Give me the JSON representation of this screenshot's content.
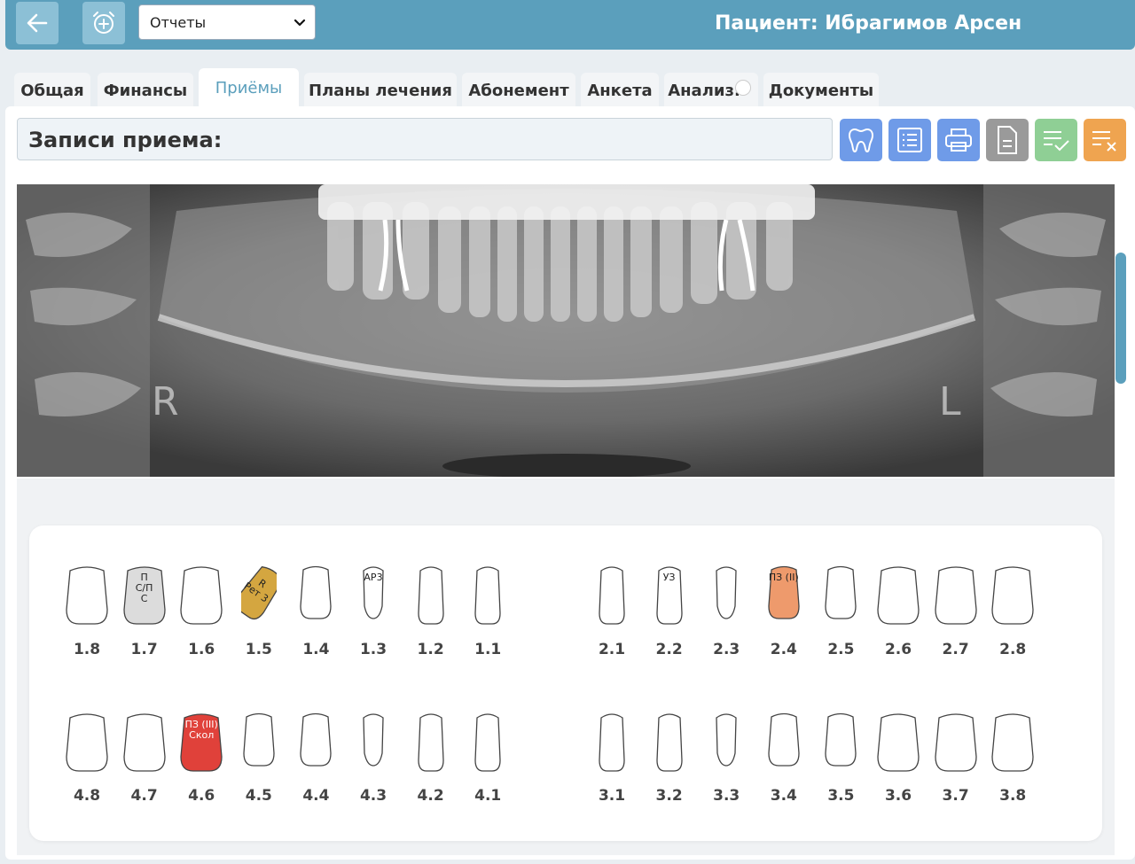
{
  "header": {
    "back_icon": "arrow-left-icon",
    "alarm_icon": "alarm-plus-icon",
    "select_value": "Отчеты",
    "patient_title": "Пациент: Ибрагимов Арсен"
  },
  "tabs": [
    {
      "label": "Общая",
      "active": false
    },
    {
      "label": "Финансы",
      "active": false
    },
    {
      "label": "Приёмы",
      "active": true
    },
    {
      "label": "Планы лечения",
      "active": false
    },
    {
      "label": "Абонемент",
      "active": false
    },
    {
      "label": "Анкета",
      "active": false
    },
    {
      "label": "Анализ.",
      "active": false
    },
    {
      "label": "Документы",
      "active": false
    }
  ],
  "records": {
    "title": "Записи приема:"
  },
  "toolbar": {
    "colors": {
      "blue": "#6f9be8",
      "gray": "#9a9a9a",
      "green": "#8fcf95",
      "orange": "#efa450"
    },
    "buttons": [
      {
        "icon": "tooth-icon",
        "color": "blue"
      },
      {
        "icon": "list-icon",
        "color": "blue"
      },
      {
        "icon": "printer-icon",
        "color": "blue"
      },
      {
        "icon": "document-icon",
        "color": "gray"
      },
      {
        "icon": "list-check-icon",
        "color": "green"
      },
      {
        "icon": "list-remove-icon",
        "color": "orange"
      }
    ]
  },
  "xray": {
    "left_marker": "R",
    "right_marker": "L"
  },
  "dental_chart": {
    "status_colors": {
      "gray": "#dcdcdc",
      "gold": "#d4a640",
      "orange": "#ee9a6c",
      "red": "#e0413a"
    },
    "upper_right": [
      {
        "number": "1.8",
        "shape": "molar",
        "mark": "",
        "fill": ""
      },
      {
        "number": "1.7",
        "shape": "molar",
        "mark": "П\nС/П\nС",
        "fill": "gray"
      },
      {
        "number": "1.6",
        "shape": "molar",
        "mark": "",
        "fill": ""
      },
      {
        "number": "1.5",
        "shape": "premolar",
        "mark": "R\nРет 3",
        "fill": "gold"
      },
      {
        "number": "1.4",
        "shape": "premolar",
        "mark": "",
        "fill": ""
      },
      {
        "number": "1.3",
        "shape": "canine",
        "mark": "АР3",
        "fill": ""
      },
      {
        "number": "1.2",
        "shape": "incisor",
        "mark": "",
        "fill": ""
      },
      {
        "number": "1.1",
        "shape": "incisor",
        "mark": "",
        "fill": ""
      }
    ],
    "upper_left": [
      {
        "number": "2.1",
        "shape": "incisor",
        "mark": "",
        "fill": ""
      },
      {
        "number": "2.2",
        "shape": "incisor",
        "mark": "УЗ",
        "fill": ""
      },
      {
        "number": "2.3",
        "shape": "canine",
        "mark": "",
        "fill": ""
      },
      {
        "number": "2.4",
        "shape": "premolar",
        "mark": "ПЗ (II)",
        "fill": "orange"
      },
      {
        "number": "2.5",
        "shape": "premolar",
        "mark": "",
        "fill": ""
      },
      {
        "number": "2.6",
        "shape": "molar",
        "mark": "",
        "fill": ""
      },
      {
        "number": "2.7",
        "shape": "molar",
        "mark": "",
        "fill": ""
      },
      {
        "number": "2.8",
        "shape": "molar",
        "mark": "",
        "fill": ""
      }
    ],
    "lower_right": [
      {
        "number": "4.8",
        "shape": "molar",
        "mark": "",
        "fill": ""
      },
      {
        "number": "4.7",
        "shape": "molar",
        "mark": "",
        "fill": ""
      },
      {
        "number": "4.6",
        "shape": "molar",
        "mark": "ПЗ (III)\nСкол",
        "fill": "red"
      },
      {
        "number": "4.5",
        "shape": "premolar",
        "mark": "",
        "fill": ""
      },
      {
        "number": "4.4",
        "shape": "premolar",
        "mark": "",
        "fill": ""
      },
      {
        "number": "4.3",
        "shape": "canine",
        "mark": "",
        "fill": ""
      },
      {
        "number": "4.2",
        "shape": "incisor",
        "mark": "",
        "fill": ""
      },
      {
        "number": "4.1",
        "shape": "incisor",
        "mark": "",
        "fill": ""
      }
    ],
    "lower_left": [
      {
        "number": "3.1",
        "shape": "incisor",
        "mark": "",
        "fill": ""
      },
      {
        "number": "3.2",
        "shape": "incisor",
        "mark": "",
        "fill": ""
      },
      {
        "number": "3.3",
        "shape": "canine",
        "mark": "",
        "fill": ""
      },
      {
        "number": "3.4",
        "shape": "premolar",
        "mark": "",
        "fill": ""
      },
      {
        "number": "3.5",
        "shape": "premolar",
        "mark": "",
        "fill": ""
      },
      {
        "number": "3.6",
        "shape": "molar",
        "mark": "",
        "fill": ""
      },
      {
        "number": "3.7",
        "shape": "molar",
        "mark": "",
        "fill": ""
      },
      {
        "number": "3.8",
        "shape": "molar",
        "mark": "",
        "fill": ""
      }
    ]
  }
}
